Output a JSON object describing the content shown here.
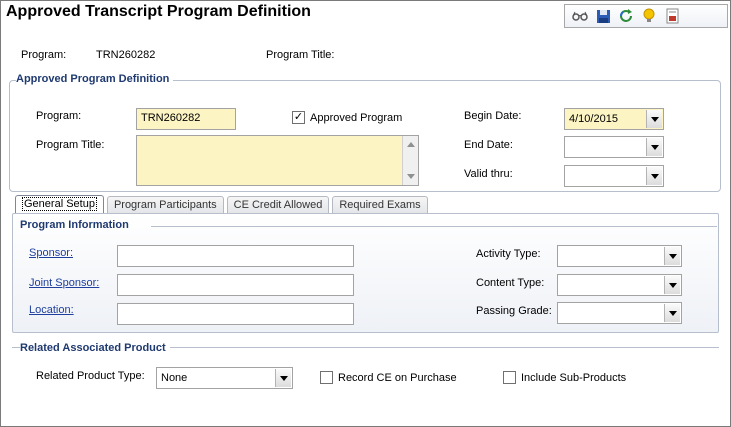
{
  "window": {
    "title": "Approved Transcript Program Definition"
  },
  "toolbar": {
    "icons": [
      "glasses-icon",
      "save-icon",
      "refresh-icon",
      "lightbulb-icon",
      "report-icon"
    ]
  },
  "header": {
    "program_label": "Program:",
    "program_value": "TRN260282",
    "program_title_label": "Program Title:",
    "program_title_value": ""
  },
  "definition": {
    "group_title": "Approved Program Definition",
    "program_label": "Program:",
    "program_value": "TRN260282",
    "approved_label": "Approved Program",
    "approved_checked": true,
    "program_title_label": "Program Title:",
    "program_title_value": "",
    "begin_date_label": "Begin Date:",
    "begin_date_value": "4/10/2015",
    "end_date_label": "End Date:",
    "end_date_value": "",
    "valid_thru_label": "Valid thru:",
    "valid_thru_value": ""
  },
  "tabs": [
    "General Setup",
    "Program Participants",
    "CE Credit Allowed",
    "Required Exams"
  ],
  "program_info": {
    "group_title": "Program Information",
    "sponsor_label": "Sponsor:",
    "joint_sponsor_label": "Joint Sponsor:",
    "location_label": "Location:",
    "activity_type_label": "Activity Type:",
    "content_type_label": "Content Type:",
    "passing_grade_label": "Passing Grade:",
    "sponsor_value": "",
    "joint_sponsor_value": "",
    "location_value": "",
    "activity_type_value": "",
    "content_type_value": "",
    "passing_grade_value": ""
  },
  "related": {
    "group_title": "Related Associated Product",
    "product_type_label": "Related Product Type:",
    "product_type_value": "None",
    "record_ce_label": "Record CE on Purchase",
    "record_ce_checked": false,
    "include_sub_label": "Include Sub-Products",
    "include_sub_checked": false
  },
  "colors": {
    "required_bg": "#fdf4c4",
    "group_title": "#1f3a70",
    "link": "#1f3f9c"
  }
}
